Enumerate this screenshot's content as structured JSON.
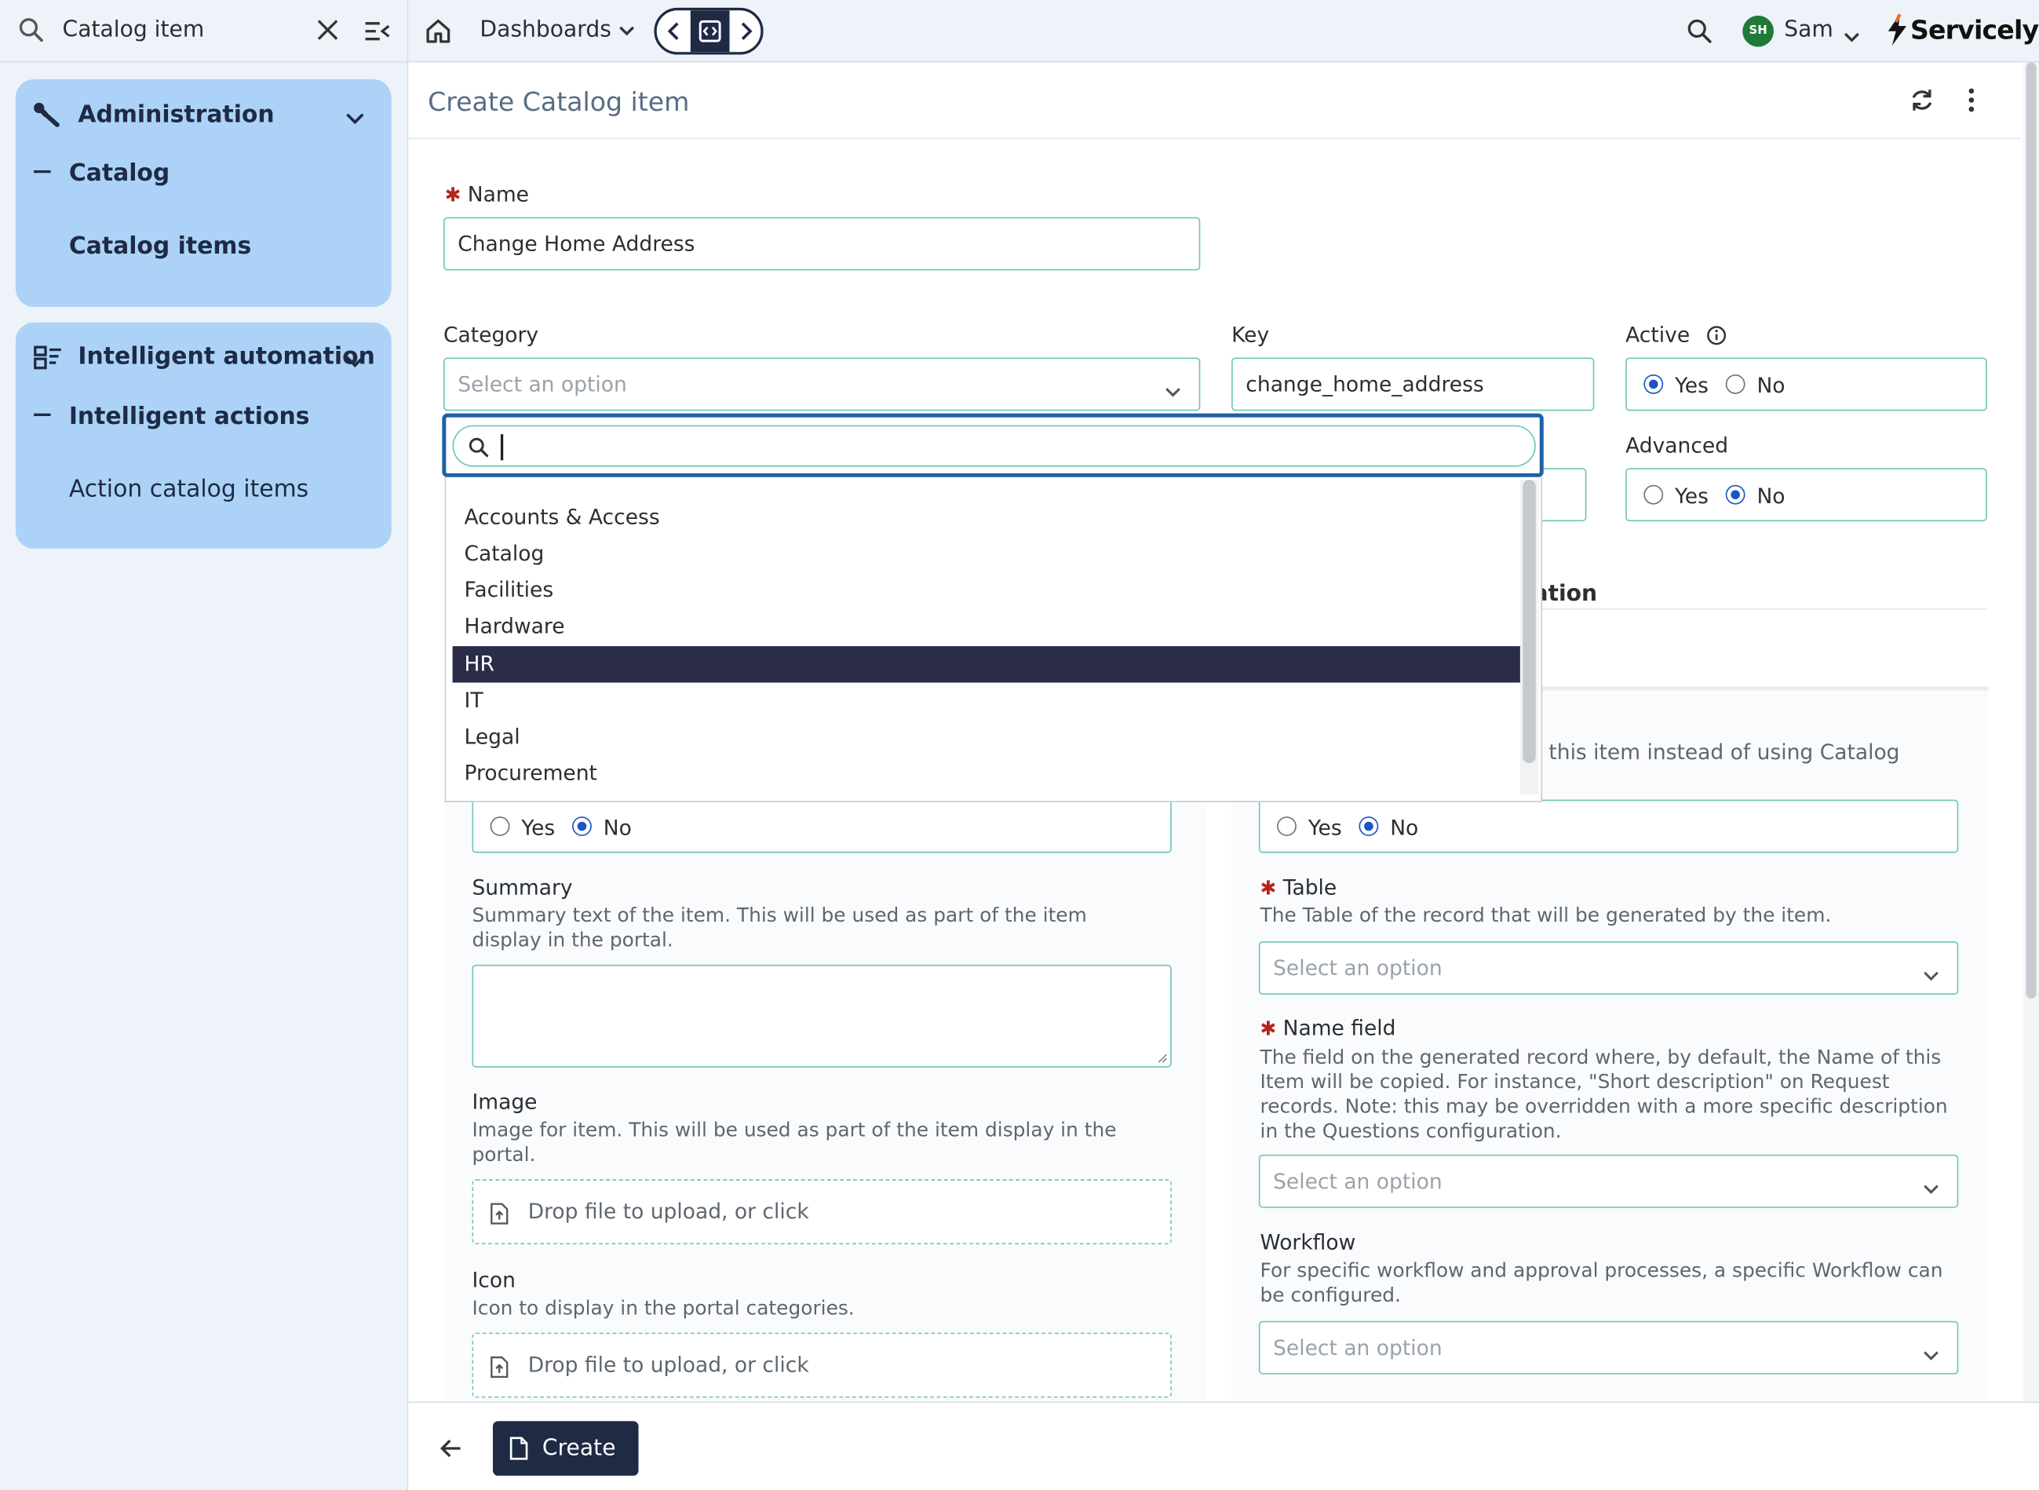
{
  "sidebar": {
    "search_value": "Catalog item",
    "groups": [
      {
        "title": "Administration",
        "icon": "wrench-icon",
        "sub": "Catalog",
        "leaf": "Catalog items"
      },
      {
        "title": "Intelligent automation",
        "icon": "automation-icon",
        "sub": "Intelligent actions",
        "leaf": "Action catalog items"
      }
    ]
  },
  "topbar": {
    "dashboards_label": "Dashboards",
    "user_initials": "SH",
    "user_name": "Sam",
    "brand": "Servicely",
    "avatar_color": "#1f7a3a"
  },
  "page": {
    "title": "Create Catalog item"
  },
  "form": {
    "name": {
      "label": "Name",
      "value": "Change Home Address"
    },
    "category": {
      "label": "Category",
      "placeholder": "Select an option"
    },
    "key": {
      "label": "Key",
      "value": "change_home_address"
    },
    "active": {
      "label": "Active",
      "yes": "Yes",
      "no": "No",
      "selected": "Yes"
    },
    "advanced": {
      "label": "Advanced",
      "yes": "Yes",
      "no": "No",
      "selected": "No"
    },
    "section_fragment": "ation",
    "left_radio": {
      "yes": "Yes",
      "no": "No",
      "selected": "No"
    },
    "summary": {
      "label": "Summary",
      "description": "Summary text of the item. This will be used as part of the item display in the portal."
    },
    "image": {
      "label": "Image",
      "description": "Image for item. This will be used as part of the item display in the portal.",
      "drop": "Drop file to upload, or click"
    },
    "icon": {
      "label": "Icon",
      "description": "Icon to display in the portal categories.",
      "drop": "Drop file to upload, or click"
    },
    "right_fragment": "this item instead of using Catalog",
    "right_radio": {
      "yes": "Yes",
      "no": "No",
      "selected": "No"
    },
    "table": {
      "label": "Table",
      "description": "The Table of the record that will be generated by the item.",
      "placeholder": "Select an option"
    },
    "name_field": {
      "label": "Name field",
      "description": "The field on the generated record where, by default, the Name of this Item will be copied. For instance, \"Short description\" on Request records. Note: this may be overridden with a more specific description in the Questions configuration.",
      "placeholder": "Select an option"
    },
    "workflow": {
      "label": "Workflow",
      "description": "For specific workflow and approval processes, a specific Workflow can be configured.",
      "placeholder": "Select an option"
    }
  },
  "dropdown": {
    "search_value": "",
    "options": [
      "Accounts & Access",
      "Catalog",
      "Facilities",
      "Hardware",
      "HR",
      "IT",
      "Legal",
      "Procurement"
    ],
    "highlighted": "HR"
  },
  "footer": {
    "create_label": "Create"
  },
  "colors": {
    "accent_dark": "#1f2a44",
    "nav_card": "#acd3f7",
    "field_border": "#6fc6b8",
    "required": "#b3261e",
    "highlight": "#2a2c48"
  }
}
